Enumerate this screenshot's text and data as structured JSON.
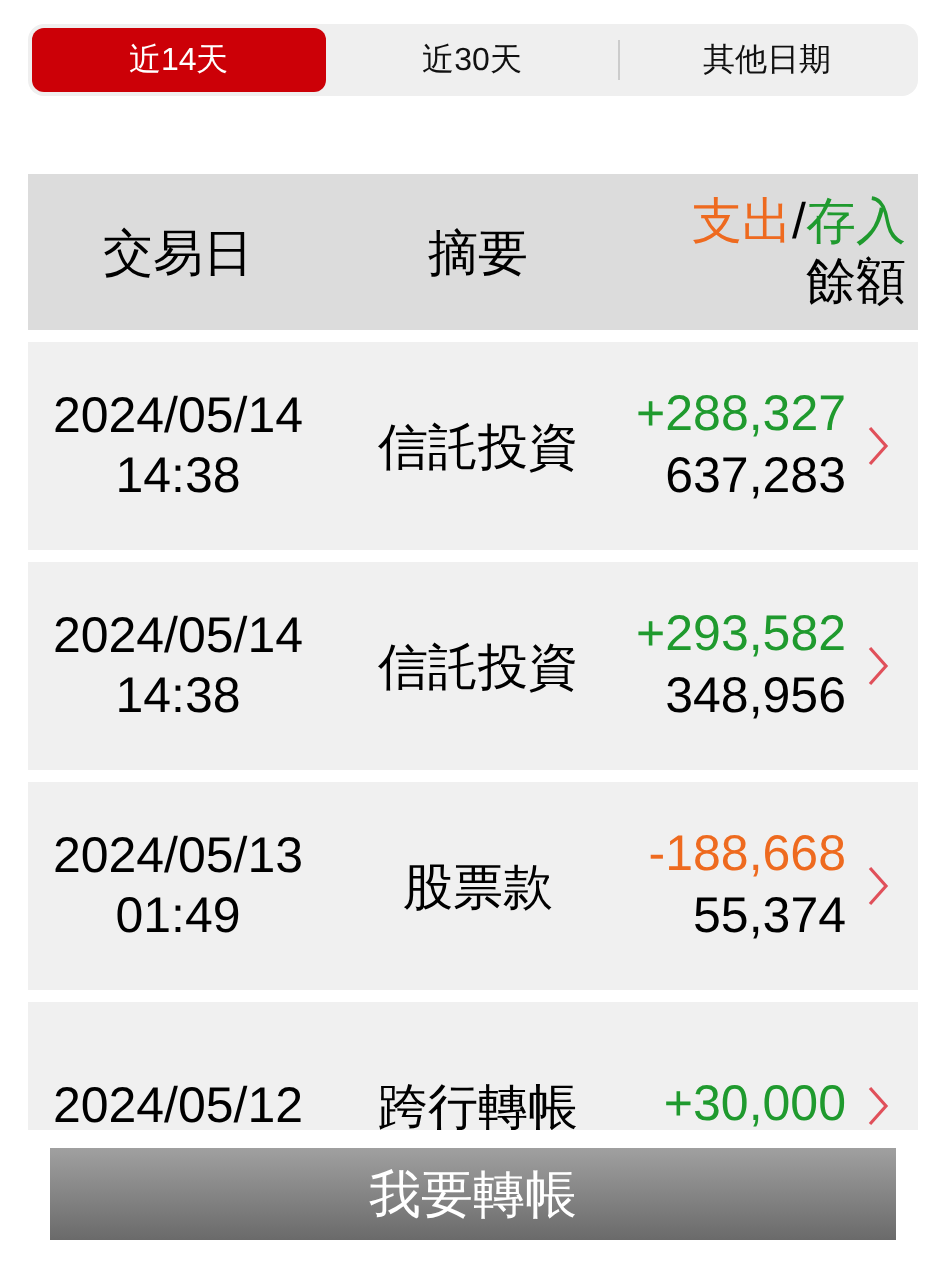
{
  "tabs": [
    {
      "label": "近14天",
      "selected": true
    },
    {
      "label": "近30天",
      "selected": false
    },
    {
      "label": "其他日期",
      "selected": false
    }
  ],
  "table": {
    "columns": {
      "date": "交易日",
      "summary": "摘要",
      "expense": "支出",
      "separator": "/",
      "deposit": "存入",
      "balance": "餘額"
    },
    "rows": [
      {
        "date": "2024/05/14",
        "time": "14:38",
        "summary": "信託投資",
        "kind": "deposit",
        "amount": "+288,327",
        "balance": "637,283"
      },
      {
        "date": "2024/05/14",
        "time": "14:38",
        "summary": "信託投資",
        "kind": "deposit",
        "amount": "+293,582",
        "balance": "348,956"
      },
      {
        "date": "2024/05/13",
        "time": "01:49",
        "summary": "股票款",
        "kind": "expense",
        "amount": "-188,668",
        "balance": "55,374"
      },
      {
        "date": "2024/05/12",
        "summary": "跨行轉帳",
        "kind": "deposit",
        "amount": "+30,000"
      }
    ]
  },
  "transfer_button": "我要轉帳"
}
